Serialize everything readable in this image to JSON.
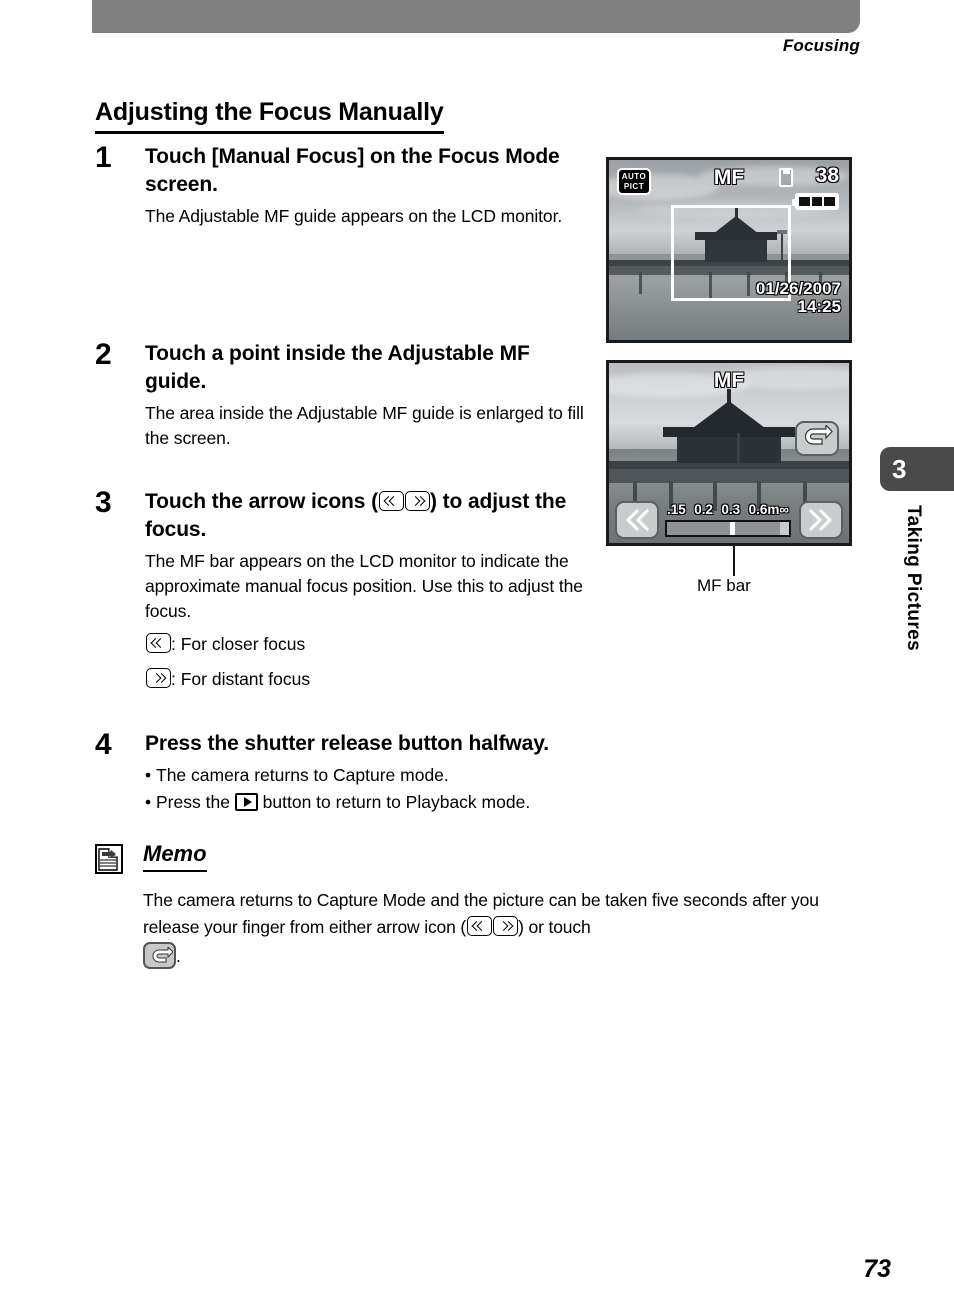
{
  "header": {
    "running_head": "Focusing"
  },
  "section": {
    "heading": "Adjusting the Focus Manually"
  },
  "steps": [
    {
      "num": "1",
      "title": "Touch [Manual Focus] on the Focus Mode screen.",
      "desc": "The Adjustable MF guide appears on the LCD monitor."
    },
    {
      "num": "2",
      "title": "Touch a point inside the Adjustable MF guide.",
      "desc": "The area inside the Adjustable MF guide is enlarged to fill the screen."
    },
    {
      "num": "3",
      "title_before": "Touch the arrow icons (",
      "title_after": ") to adjust the focus.",
      "desc": "The MF bar appears on the LCD monitor to indicate the approximate manual focus position. Use this to adjust the focus.",
      "legend_closer": ": For closer focus",
      "legend_distant": ": For distant focus"
    },
    {
      "num": "4",
      "title": "Press the shutter release button halfway.",
      "bullet1": "The camera returns to Capture mode.",
      "bullet2_before": "Press the ",
      "bullet2_after": " button to return to Playback mode."
    }
  ],
  "memo": {
    "title": "Memo",
    "text_part1": "The camera returns to Capture Mode and the picture can be taken five seconds after you release your finger from either arrow icon (",
    "text_part2": ") or touch",
    "text_part3": "."
  },
  "screen1": {
    "mode_badge_line1": "AUTO",
    "mode_badge_line2": "PICT",
    "focus_mode": "MF",
    "remaining_shots": "38",
    "date": "01/26/2007",
    "time": "14:25"
  },
  "screen2": {
    "focus_mode": "MF",
    "scale": [
      ".15",
      "0.2",
      "0.3",
      "0.6m∞"
    ]
  },
  "callout": {
    "mf_bar_label": "MF bar"
  },
  "side_tab": {
    "chapter_number": "3",
    "chapter_title": "Taking Pictures"
  },
  "footer": {
    "page_number": "73"
  }
}
